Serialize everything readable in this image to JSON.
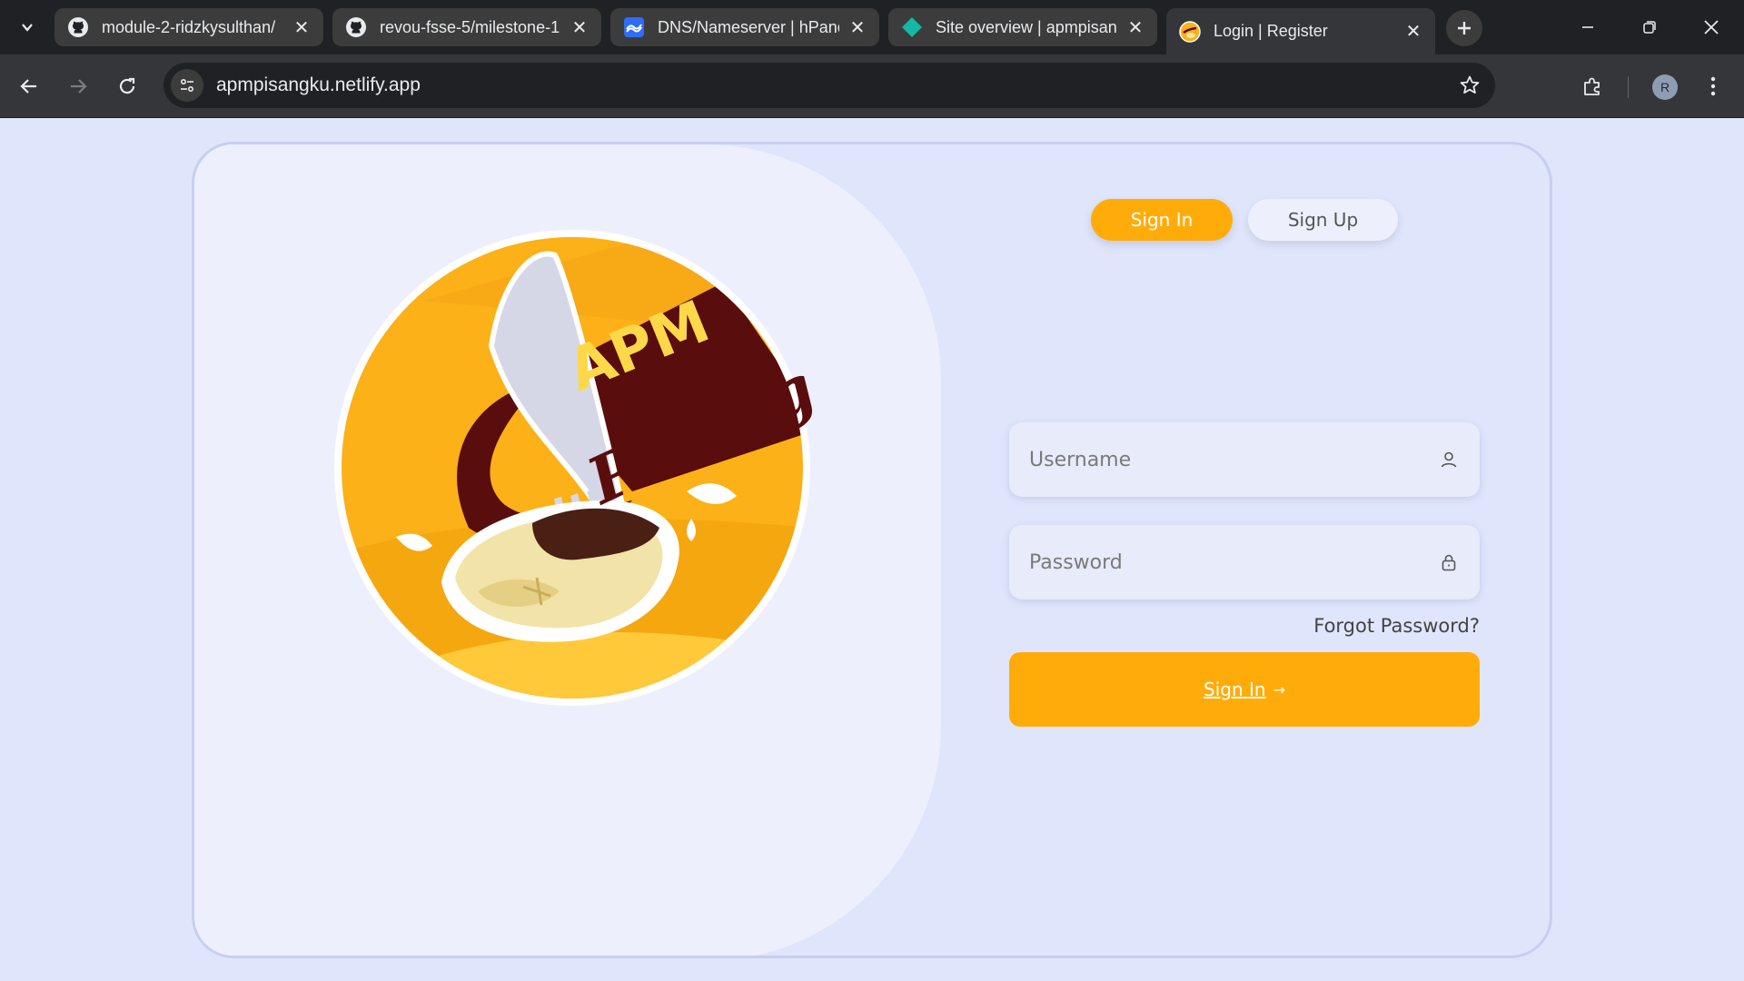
{
  "browser": {
    "tabs": [
      {
        "title": "module-2-ridzkysulthan/",
        "favicon": "github-icon",
        "active": false
      },
      {
        "title": "revou-fsse-5/milestone-1",
        "favicon": "github-icon",
        "active": false
      },
      {
        "title": "DNS/Nameserver | hPanel",
        "favicon": "hpanel-icon",
        "active": false
      },
      {
        "title": "Site overview | apmpisangku",
        "favicon": "netlify-icon",
        "active": false
      },
      {
        "title": "Login | Register",
        "favicon": "apm-logo-icon",
        "active": true
      }
    ],
    "url": "apmpisangku.netlify.app",
    "profile_initial": "R"
  },
  "logo": {
    "line1": "APM",
    "line2": "Pisang"
  },
  "auth": {
    "signin_tab": "Sign In",
    "signup_tab": "Sign Up",
    "username_placeholder": "Username",
    "password_placeholder": "Password",
    "forgot": "Forgot Password?",
    "submit": "Sign In",
    "submit_arrow": "→"
  },
  "colors": {
    "accent": "#ffac0b",
    "page_bg": "#dfe5fb",
    "panel_bg": "#edf0fc",
    "logo_brown": "#5a0d0d"
  }
}
